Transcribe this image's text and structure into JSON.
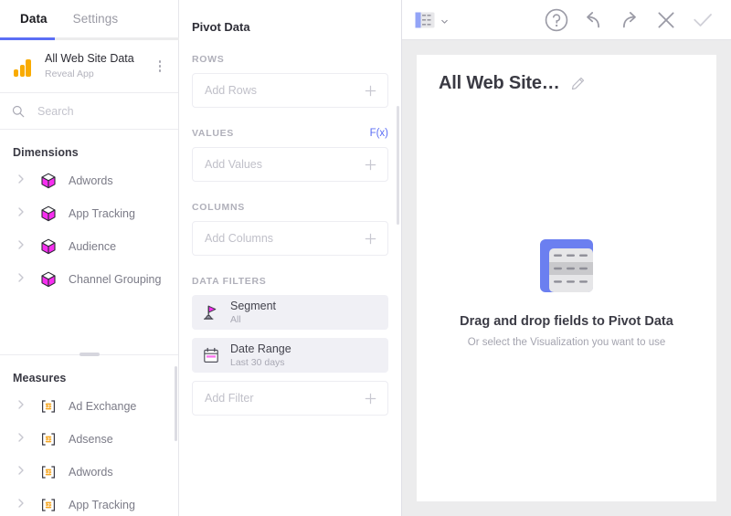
{
  "left": {
    "tabs": [
      {
        "label": "Data",
        "active": true
      },
      {
        "label": "Settings",
        "active": false
      }
    ],
    "source": {
      "title": "All Web Site Data",
      "subtitle": "Reveal App",
      "logo": "google-analytics-logo",
      "menu_icon": "kebab-menu-icon"
    },
    "search": {
      "placeholder": "Search",
      "value": "",
      "icon": "search-icon"
    },
    "dimensions": {
      "title": "Dimensions",
      "icon": "cube-icon",
      "items": [
        {
          "label": "Adwords"
        },
        {
          "label": "App Tracking"
        },
        {
          "label": "Audience"
        },
        {
          "label": "Channel Grouping"
        }
      ]
    },
    "measures": {
      "title": "Measures",
      "icon": "numeric-123-icon",
      "items": [
        {
          "label": "Ad Exchange"
        },
        {
          "label": "Adsense"
        },
        {
          "label": "Adwords"
        },
        {
          "label": "App Tracking"
        }
      ]
    }
  },
  "middle": {
    "title": "Pivot Data",
    "groups": [
      {
        "key": "rows",
        "label": "ROWS",
        "placeholder": "Add Rows",
        "action_icon": "plus-icon"
      },
      {
        "key": "values",
        "label": "VALUES",
        "placeholder": "Add Values",
        "action_icon": "plus-icon",
        "fx_label": "F(x)"
      },
      {
        "key": "columns",
        "label": "COLUMNS",
        "placeholder": "Add Columns",
        "action_icon": "plus-icon"
      }
    ],
    "filters_label": "DATA FILTERS",
    "filters": [
      {
        "name": "Segment",
        "value": "All",
        "icon": "segment-flag-icon"
      },
      {
        "name": "Date Range",
        "value": "Last 30 days",
        "icon": "calendar-icon"
      }
    ],
    "add_filter": {
      "placeholder": "Add Filter",
      "action_icon": "plus-icon"
    }
  },
  "right": {
    "toolbar": {
      "viz_icon": "pivot-table-icon",
      "viz_chevron": "chevron-down-icon",
      "help_label": "?",
      "buttons": [
        {
          "name": "help",
          "icon": "help-circle-icon"
        },
        {
          "name": "undo",
          "icon": "undo-arrow-icon"
        },
        {
          "name": "redo",
          "icon": "redo-arrow-icon"
        },
        {
          "name": "close",
          "icon": "close-x-icon"
        },
        {
          "name": "confirm",
          "icon": "check-icon"
        }
      ]
    },
    "card": {
      "title": "All Web Site…",
      "edit_icon": "pencil-icon",
      "empty_state": {
        "art": "pivot-table-placeholder-icon",
        "headline": "Drag and drop fields to Pivot Data",
        "subtext": "Or select the Visualization you want to use"
      }
    }
  },
  "colors": {
    "accent_blue": "#5b6ef5",
    "magenta": "#f72ef0",
    "measure_orange": "#f5a623",
    "ga_orange": "#f9ab00",
    "panel_bg": "#ececed",
    "filter_bg": "#f0f0f5"
  }
}
